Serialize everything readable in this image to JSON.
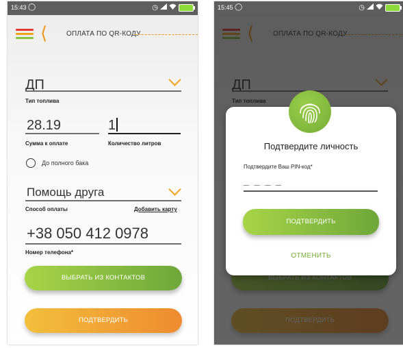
{
  "status_left": {
    "time": "15:43"
  },
  "status_right": {
    "time": "15:45"
  },
  "header": {
    "title": "ОПЛАТА ПО QR-КОДУ"
  },
  "form": {
    "fuel": {
      "value": "ДП",
      "label": "Тип топлива"
    },
    "amount": {
      "value": "28.19",
      "label": "Сумма к оплате"
    },
    "liters": {
      "value": "1",
      "label": "Количество литров"
    },
    "full_tank": {
      "label": "До полного бака"
    },
    "payment": {
      "value": "Помощь друга",
      "label": "Способ оплаты",
      "add_card": "Добавить карту"
    },
    "phone": {
      "value": "+38 050 412 0978",
      "label": "Номер телефона*"
    }
  },
  "buttons": {
    "contacts": "ВЫБРАТЬ ИЗ КОНТАКТОВ",
    "confirm": "ПОДТВЕРДИТЬ"
  },
  "modal": {
    "title": "Подтвердите личность",
    "pin_label": "Подтвердите Ваш PIN-код*",
    "pin_placeholder": "_ _ _ _",
    "confirm": "ПОДТВЕРДИТЬ",
    "cancel": "ОТМЕНИТЬ"
  },
  "colors": {
    "accent_orange": "#f0961a",
    "accent_green": "#79ad35",
    "menu_red": "#e53b2e",
    "menu_yellow": "#f2a21b",
    "menu_green": "#8cc43a"
  },
  "icons": [
    "sync-icon",
    "alarm-icon",
    "signal-icon",
    "wifi-icon",
    "battery-icon",
    "menu-icon",
    "back-arrow-icon",
    "chevron-down-icon",
    "radio-icon",
    "fingerprint-icon"
  ]
}
